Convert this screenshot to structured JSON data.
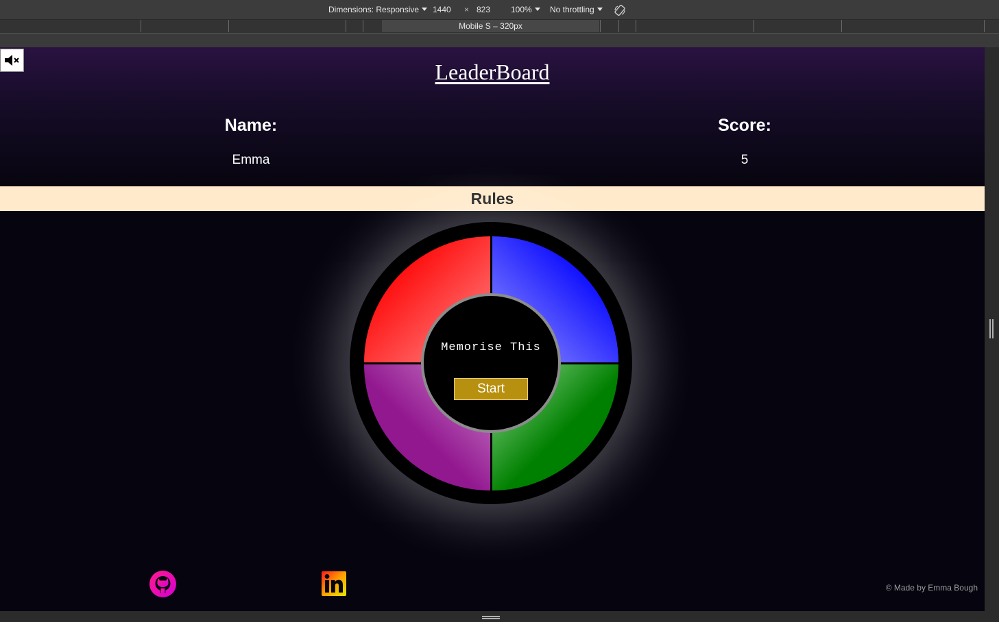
{
  "devtools": {
    "dimensions_label": "Dimensions: Responsive",
    "width_value": "1440",
    "times_sign": "×",
    "height_value": "823",
    "zoom_label": "100%",
    "throttling_label": "No throttling",
    "device_preset_label": "Mobile S – 320px"
  },
  "leaderboard": {
    "title": "LeaderBoard",
    "name_header": "Name:",
    "score_header": "Score:",
    "entries": [
      {
        "name": "Emma",
        "score": "5"
      }
    ]
  },
  "rules": {
    "label": "Rules"
  },
  "game": {
    "center_text": "Memorise This",
    "start_label": "Start",
    "quadrant_colors": {
      "top_left": "#ff0000",
      "top_right": "#0000ff",
      "bottom_left": "#921890",
      "bottom_right": "#008000"
    }
  },
  "footer": {
    "github_icon": "github-icon",
    "linkedin_icon": "linkedin-icon",
    "copyright": "© Made by Emma Bough"
  },
  "mute_icon": "speaker-muted-icon"
}
